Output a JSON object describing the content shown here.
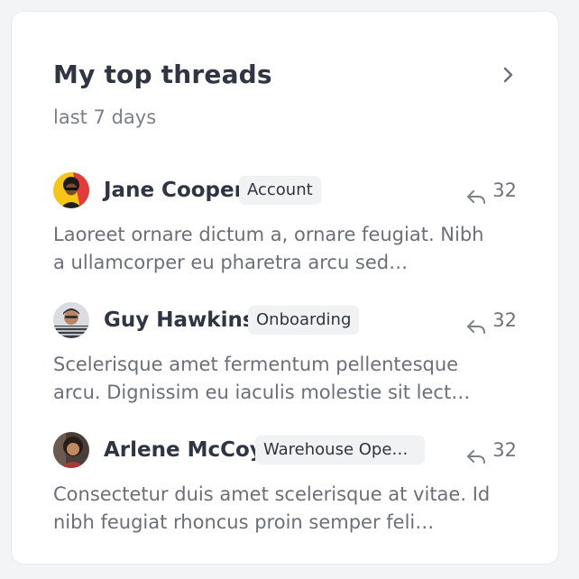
{
  "header": {
    "title": "My top threads",
    "subtitle": "last 7 days"
  },
  "threads": [
    {
      "name": "Jane Cooper",
      "tag": "Account",
      "replies": "32",
      "snippet_line1": "Laoreet ornare dictum a, ornare feugiat. Nibh",
      "snippet_line2": "a ullamcorper eu pharetra arcu sed…"
    },
    {
      "name": "Guy Hawkins",
      "tag": "Onboarding",
      "replies": "32",
      "snippet_line1": "Scelerisque amet fermentum pellentesque",
      "snippet_line2": "arcu. Dignissim eu iaculis molestie sit lect…"
    },
    {
      "name": "Arlene McCoy",
      "tag": "Warehouse Ope…",
      "replies": "32",
      "snippet_line1": "Consectetur duis amet scelerisque at vitae. Id",
      "snippet_line2": "nibh feugiat rhoncus proin semper feli…"
    }
  ],
  "icons": {
    "header_action": "chevron-right-icon",
    "reply": "reply-arrow-icon"
  },
  "colors": {
    "title": "#2f3542",
    "muted": "#6b6f78",
    "tag_bg": "#f1f2f4",
    "avatar1_bg": "#f5c518",
    "avatar1_accent": "#e23b3b"
  }
}
